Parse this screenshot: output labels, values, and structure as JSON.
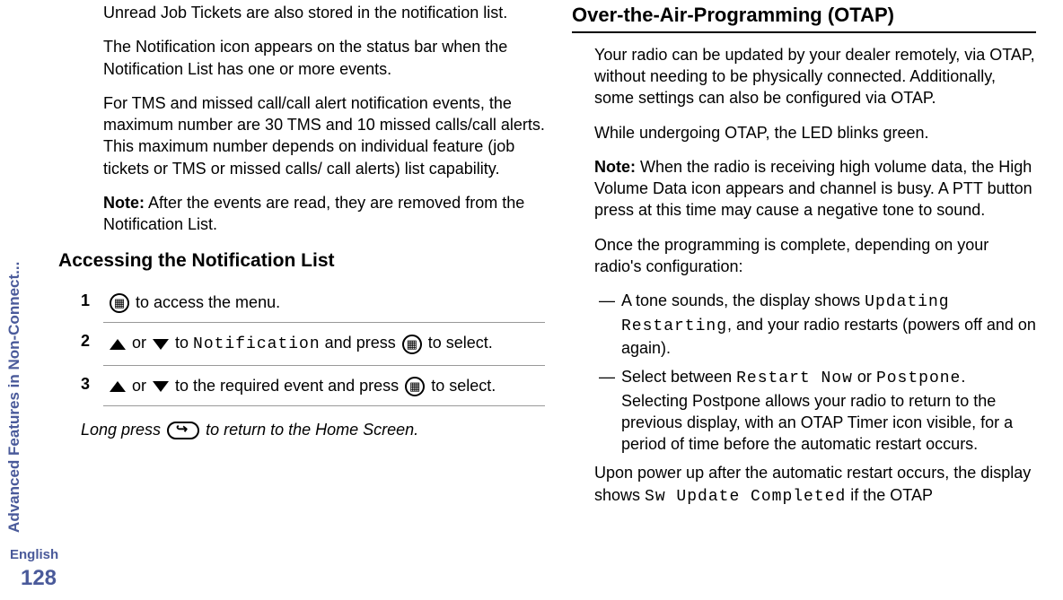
{
  "sidebar": {
    "section": "Advanced Features in Non-Connect...",
    "language": "English",
    "page": "128"
  },
  "left": {
    "p1": "Unread Job Tickets are also stored in the notification list.",
    "p2": "The Notification icon appears on the status bar when the Notification List has one or more events.",
    "p3": "For TMS and missed call/call alert notification events, the maximum number are 30 TMS and 10 missed calls/call alerts. This maximum number depends on individual feature (job tickets or TMS or missed calls/ call alerts) list capability.",
    "note_label": "Note:",
    "note_text": " After the events are read, they are removed from the Notification List.",
    "h3": "Accessing the Notification List",
    "s1_after_icon": " to access the menu.",
    "s2_or": " or ",
    "s2_to": " to ",
    "s2_notif": "Notification",
    "s2_press": " and press ",
    "s2_select": " to select.",
    "s3_or": " or ",
    "s3_mid": " to the required event and press ",
    "s3_select": " to select.",
    "foot_a": "Long press ",
    "foot_b": " to return to the Home Screen."
  },
  "right": {
    "h2": "Over-the-Air-Programming (OTAP)",
    "p1": "Your radio can be updated by your dealer remotely, via OTAP, without needing to be physically connected. Additionally, some settings can also be configured via OTAP.",
    "p2": "While undergoing OTAP, the LED blinks green.",
    "note_label": "Note:",
    "note_text": " When the radio is receiving high volume data, the High Volume Data icon appears and channel is busy. A PTT button press at this time may cause a negative tone to sound.",
    "p3": "Once the programming is complete, depending on your radio's configuration:",
    "d1_a": "A tone sounds, the display shows ",
    "d1_mono": "Updating Restarting",
    "d1_b": ", and your radio restarts (powers off and on again).",
    "d2_a": "Select between ",
    "d2_m1": "Restart Now",
    "d2_or": " or ",
    "d2_m2": "Postpone",
    "d2_b": ". Selecting Postpone allows your radio to return to the previous display, with an OTAP Timer icon visible, for a period of time before the automatic restart occurs.",
    "p4_a": "Upon power up after the automatic restart occurs, the display shows ",
    "p4_mono": "Sw Update Completed",
    "p4_b": " if the OTAP"
  }
}
